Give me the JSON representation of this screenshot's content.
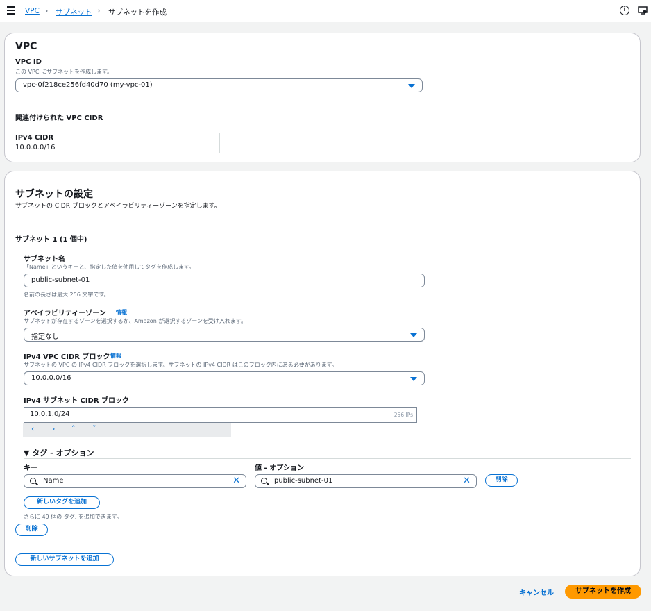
{
  "breadcrumb": {
    "vpc": "VPC",
    "subnets": "サブネット",
    "current": "サブネットを作成"
  },
  "vpc_panel": {
    "title": "VPC",
    "vpc_id_label": "VPC ID",
    "vpc_id_desc": "この VPC にサブネットを作成します。",
    "vpc_id_value": "vpc-0f218ce256fd40d70 (my-vpc-01)",
    "cidr_section_label": "関連付けられた VPC CIDR",
    "ipv4_cidr_label": "IPv4 CIDR",
    "ipv4_cidr_value": "10.0.0.0/16"
  },
  "subnet_panel": {
    "title": "サブネットの設定",
    "desc": "サブネットの CIDR ブロックとアベイラビリティーゾーンを指定します。",
    "subnet_heading": "サブネット 1 (1 個中)",
    "name_label": "サブネット名",
    "name_desc": "「Name」というキーと、指定した値を使用してタグを作成します。",
    "name_value": "public-subnet-01",
    "name_hint": "名前の長さは最大 256 文字です。",
    "az_label": "アベイラビリティーゾーン",
    "info_link": "情報",
    "az_desc": "サブネットが存在するゾーンを選択するか、Amazon が選択するゾーンを受け入れます。",
    "az_value": "指定なし",
    "vpc_cidr_label": "IPv4 VPC CIDR ブロック",
    "vpc_cidr_desc": "サブネットの VPC の IPv4 CIDR ブロックを選択します。サブネットの IPv4 CIDR はこのブロック内にある必要があります。",
    "vpc_cidr_value": "10.0.0.0/16",
    "subnet_cidr_label": "IPv4 サブネット CIDR ブロック",
    "subnet_cidr_value": "10.0.1.0/24",
    "subnet_cidr_count": "256 IPs",
    "steppers": [
      "‹",
      "›",
      "˄",
      "˅"
    ],
    "tags_toggle": "▼ タグ - オプション",
    "key_label": "キー",
    "value_label": "値 - オプション",
    "tag_key": "Name",
    "tag_value": "public-subnet-01",
    "remove_tag": "削除",
    "add_tag": "新しいタグを追加",
    "tag_hint": "さらに 49 個の タグ. を追加できます。",
    "remove_subnet": "削除",
    "add_subnet": "新しいサブネットを追加"
  },
  "footer": {
    "cancel": "キャンセル",
    "create": "サブネットを作成"
  },
  "icons": {
    "menu": "menu-icon",
    "info": "info-icon",
    "notifications": "notifications-icon"
  },
  "colors": {
    "link": "#0972d3",
    "primary": "#ff9900"
  }
}
